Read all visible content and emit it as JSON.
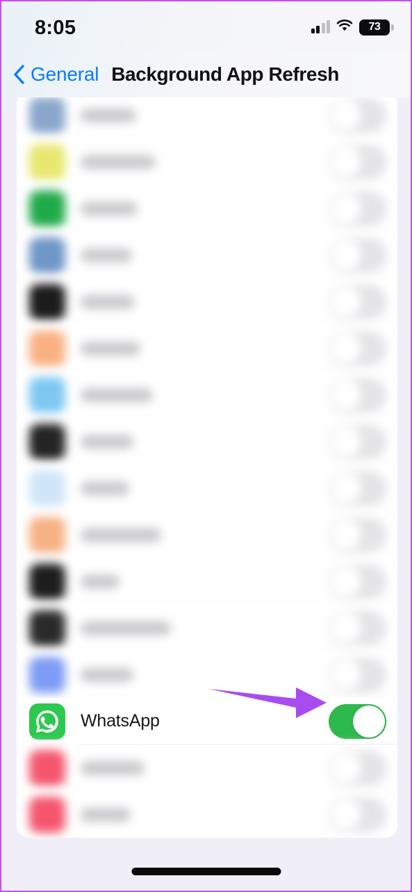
{
  "status_bar": {
    "time": "8:05",
    "battery_percent": "73",
    "cellular_icon": "cellular-bars-icon",
    "wifi_icon": "wifi-icon",
    "battery_icon": "battery-icon"
  },
  "nav_bar": {
    "back_label": "General",
    "back_icon": "chevron-left-icon",
    "title": "Background App Refresh"
  },
  "colors": {
    "accent_blue": "#0a7bff",
    "toggle_on_green": "#2eb94c",
    "toggle_off_gray": "#e4e4e7",
    "annotation_purple": "#a84cf0",
    "page_background": "#f0eff7",
    "card_background": "#ffffff",
    "border_purple": "#c64ef0"
  },
  "annotation": {
    "type": "arrow",
    "color": "#a84cf0",
    "points_to": "whatsapp-toggle",
    "direction": "right"
  },
  "list": {
    "rows": [
      {
        "name": "app-row-1",
        "label": "",
        "blurred": true,
        "icon_color": "#8aa6cd",
        "label_width": 80,
        "toggle_on": false
      },
      {
        "name": "app-row-2",
        "label": "",
        "blurred": true,
        "icon_color": "#e8e870",
        "label_width": 108,
        "toggle_on": false
      },
      {
        "name": "app-row-3",
        "label": "",
        "blurred": true,
        "icon_color": "#1faa4a",
        "label_width": 82,
        "toggle_on": false
      },
      {
        "name": "app-row-4",
        "label": "",
        "blurred": true,
        "icon_color": "#6f96c8",
        "label_width": 74,
        "toggle_on": false
      },
      {
        "name": "app-row-5",
        "label": "",
        "blurred": true,
        "icon_color": "#1b1b1b",
        "label_width": 78,
        "toggle_on": false
      },
      {
        "name": "app-row-6",
        "label": "",
        "blurred": true,
        "icon_color": "#f9b183",
        "label_width": 86,
        "toggle_on": false
      },
      {
        "name": "app-row-7",
        "label": "",
        "blurred": true,
        "icon_color": "#7ec8f2",
        "label_width": 104,
        "toggle_on": false
      },
      {
        "name": "app-row-8",
        "label": "",
        "blurred": true,
        "icon_color": "#242424",
        "label_width": 76,
        "toggle_on": false
      },
      {
        "name": "app-row-9",
        "label": "",
        "blurred": true,
        "icon_color": "#cfe6f8",
        "label_width": 70,
        "toggle_on": false
      },
      {
        "name": "app-row-10",
        "label": "",
        "blurred": true,
        "icon_color": "#f6b184",
        "label_width": 116,
        "toggle_on": false
      },
      {
        "name": "app-row-11",
        "label": "",
        "blurred": true,
        "icon_color": "#1d1d1d",
        "label_width": 56,
        "toggle_on": false
      },
      {
        "name": "app-row-12",
        "label": "",
        "blurred": true,
        "icon_color": "#2a2a2a",
        "label_width": 130,
        "toggle_on": false
      },
      {
        "name": "app-row-13",
        "label": "",
        "blurred": true,
        "icon_color": "#7d9cf5",
        "label_width": 76,
        "toggle_on": false
      },
      {
        "name": "whatsapp",
        "label": "WhatsApp",
        "blurred": false,
        "icon_color": "#2cc84f",
        "label_width": 0,
        "toggle_on": true
      },
      {
        "name": "app-row-15",
        "label": "",
        "blurred": true,
        "icon_color": "#f4566e",
        "label_width": 92,
        "toggle_on": false
      },
      {
        "name": "app-row-16",
        "label": "",
        "blurred": true,
        "icon_color": "#f4566e",
        "label_width": 72,
        "toggle_on": false
      }
    ]
  },
  "home_indicator": {
    "label": "home-indicator"
  }
}
